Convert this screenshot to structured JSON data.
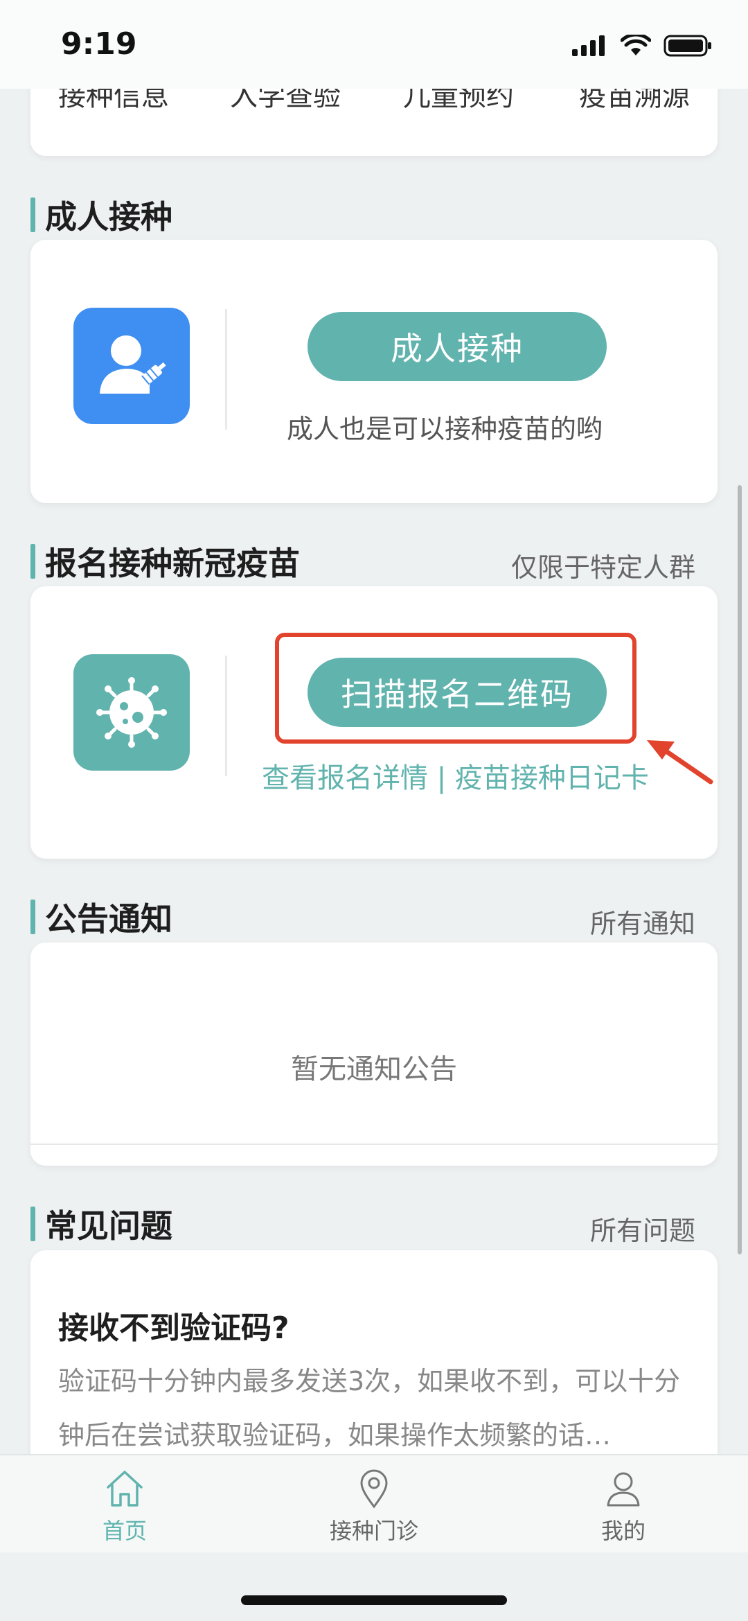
{
  "status_bar": {
    "time": "9:19"
  },
  "quick_menu": {
    "items": [
      "接种信息",
      "入学查验",
      "儿童预约",
      "疫苗溯源"
    ]
  },
  "adult": {
    "section_title": "成人接种",
    "button_label": "成人接种",
    "subtitle": "成人也是可以接种疫苗的哟"
  },
  "covid": {
    "section_title": "报名接种新冠疫苗",
    "section_link": "仅限于特定人群",
    "button_label": "扫描报名二维码",
    "links": "查看报名详情 | 疫苗接种日记卡"
  },
  "notice": {
    "section_title": "公告通知",
    "section_link": "所有通知",
    "empty_text": "暂无通知公告"
  },
  "faq": {
    "section_title": "常见问题",
    "section_link": "所有问题",
    "question": "接收不到验证码?",
    "answer": "验证码十分钟内最多发送3次，如果收不到，可以十分钟后在尝试获取验证码，如果操作太频繁的话…"
  },
  "tabbar": {
    "home": "首页",
    "clinic": "接种门诊",
    "mine": "我的"
  },
  "colors": {
    "accent": "#61b3ad",
    "adult_icon_bg": "#3f8ff2",
    "highlight": "#e2432d"
  },
  "icons": [
    "signal-icon",
    "wifi-icon",
    "battery-icon",
    "adult-vaccine-icon",
    "virus-icon",
    "home-icon",
    "location-pin-icon",
    "person-icon"
  ]
}
